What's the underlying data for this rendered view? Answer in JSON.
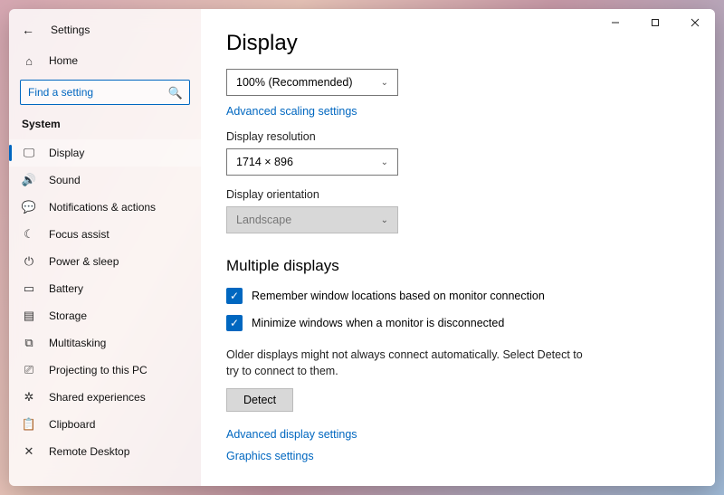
{
  "window": {
    "title": "Settings"
  },
  "sidebar": {
    "home_label": "Home",
    "search_placeholder": "Find a setting",
    "section_label": "System",
    "items": [
      {
        "icon": "display-icon",
        "glyph": "🖵",
        "label": "Display",
        "active": true
      },
      {
        "icon": "sound-icon",
        "glyph": "🔊",
        "label": "Sound"
      },
      {
        "icon": "notifications-icon",
        "glyph": "💬",
        "label": "Notifications & actions"
      },
      {
        "icon": "focus-icon",
        "glyph": "☾",
        "label": "Focus assist"
      },
      {
        "icon": "power-icon",
        "glyph": "⏻",
        "label": "Power & sleep"
      },
      {
        "icon": "battery-icon",
        "glyph": "▭",
        "label": "Battery"
      },
      {
        "icon": "storage-icon",
        "glyph": "▤",
        "label": "Storage"
      },
      {
        "icon": "multitasking-icon",
        "glyph": "⧉",
        "label": "Multitasking"
      },
      {
        "icon": "projecting-icon",
        "glyph": "⎚",
        "label": "Projecting to this PC"
      },
      {
        "icon": "shared-icon",
        "glyph": "✲",
        "label": "Shared experiences"
      },
      {
        "icon": "clipboard-icon",
        "glyph": "📋",
        "label": "Clipboard"
      },
      {
        "icon": "remote-icon",
        "glyph": "✕",
        "label": "Remote Desktop"
      }
    ]
  },
  "main": {
    "heading": "Display",
    "scale_value": "100% (Recommended)",
    "advanced_scaling_link": "Advanced scaling settings",
    "resolution_label": "Display resolution",
    "resolution_value": "1714 × 896",
    "orientation_label": "Display orientation",
    "orientation_value": "Landscape",
    "multi_heading": "Multiple displays",
    "remember_label": "Remember window locations based on monitor connection",
    "minimize_label": "Minimize windows when a monitor is disconnected",
    "detect_para": "Older displays might not always connect automatically. Select Detect to try to connect to them.",
    "detect_button": "Detect",
    "advanced_display_link": "Advanced display settings",
    "graphics_link": "Graphics settings"
  }
}
